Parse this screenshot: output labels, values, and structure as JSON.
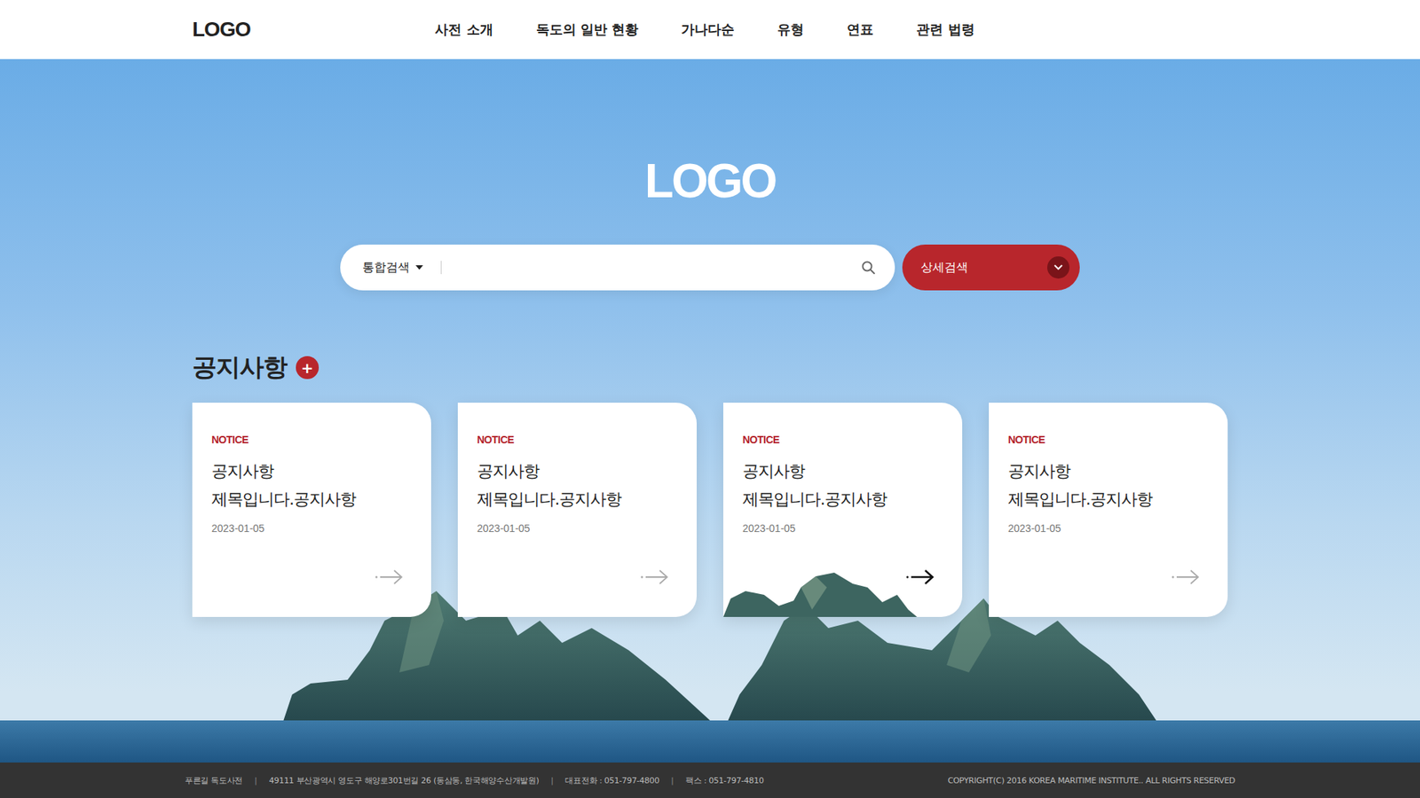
{
  "header": {
    "logo": "LOGO",
    "nav": [
      "사전 소개",
      "독도의 일반 현황",
      "가나다순",
      "유형",
      "연표",
      "관련 법령"
    ]
  },
  "hero": {
    "logo": "LOGO",
    "search": {
      "scope": "통합검색",
      "placeholder": ""
    },
    "detail_button": "상세검색"
  },
  "notices": {
    "title": "공지사항",
    "more_icon": "+",
    "cards": [
      {
        "tag": "NOTICE",
        "title_lines": [
          "공지사항",
          "제목입니다.공지사항"
        ],
        "date": "2023-01-05",
        "selected": false
      },
      {
        "tag": "NOTICE",
        "title_lines": [
          "공지사항",
          "제목입니다.공지사항"
        ],
        "date": "2023-01-05",
        "selected": false
      },
      {
        "tag": "NOTICE",
        "title_lines": [
          "공지사항",
          "제목입니다.공지사항"
        ],
        "date": "2023-01-05",
        "selected": true
      },
      {
        "tag": "NOTICE",
        "title_lines": [
          "공지사항",
          "제목입니다.공지사항"
        ],
        "date": "2023-01-05",
        "selected": false
      }
    ]
  },
  "footer": {
    "separator": "|",
    "items": [
      "푸른길 독도사전",
      "49111 부산광역시 영도구 해양로301번길 26 (동삼동, 한국해양수산개발원)",
      "대표전화 : 051-797-4800",
      "팩스 : 051-797-4810"
    ],
    "copyright": "COPYRIGHT(C) 2016 KOREA MARITIME INSTITUTE.. ALL RIGHTS RESERVED"
  }
}
